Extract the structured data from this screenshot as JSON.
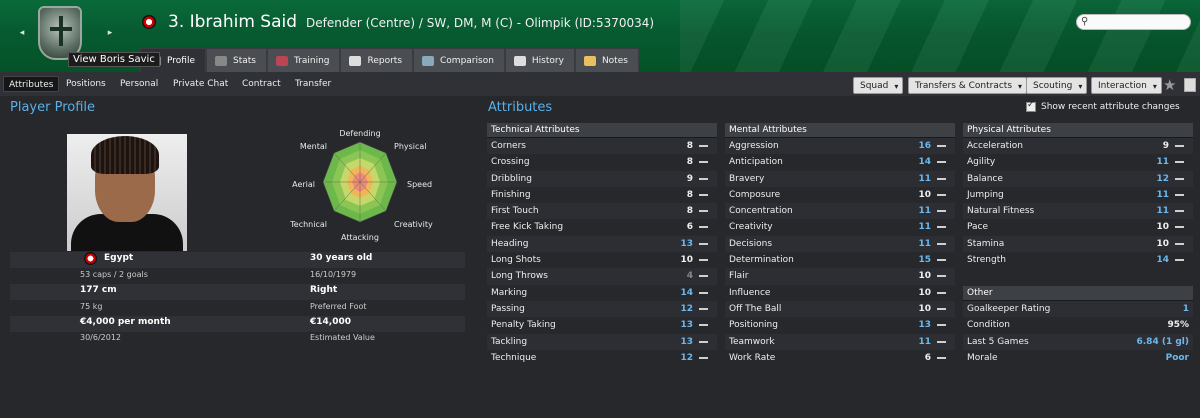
{
  "header": {
    "player_name": "3. Ibrahim Said",
    "player_sub": "Defender (Centre) / SW, DM, M (C) - Olimpik (ID:5370034)",
    "tooltip": "View Boris Savic",
    "search_placeholder": ""
  },
  "tabs": [
    "Profile",
    "Stats",
    "Training",
    "Reports",
    "Comparison",
    "History",
    "Notes"
  ],
  "subnav": [
    "Attributes",
    "Positions",
    "Personal",
    "Private Chat",
    "Contract",
    "Transfer"
  ],
  "dropdowns": [
    "Squad",
    "Transfers & Contracts",
    "Scouting",
    "Interaction"
  ],
  "profile": {
    "title": "Player Profile",
    "nation": "Egypt",
    "caps": "53 caps / 2 goals",
    "age": "30 years old",
    "dob": "16/10/1979",
    "height": "177 cm",
    "foot": "Right",
    "weight": "75 kg",
    "foot_label": "Preferred Foot",
    "wage": "€4,000 per month",
    "value": "€14,000",
    "contract_end": "30/6/2012",
    "value_label": "Estimated Value"
  },
  "radar_labels": {
    "defending": "Defending",
    "physical": "Physical",
    "speed": "Speed",
    "creativity": "Creativity",
    "attacking": "Attacking",
    "technical": "Technical",
    "aerial": "Aerial",
    "mental": "Mental"
  },
  "attributes": {
    "title": "Attributes",
    "show_changes": "Show recent attribute changes",
    "technical": {
      "title": "Technical Attributes",
      "rows": [
        {
          "name": "Corners",
          "value": "8"
        },
        {
          "name": "Crossing",
          "value": "8"
        },
        {
          "name": "Dribbling",
          "value": "9"
        },
        {
          "name": "Finishing",
          "value": "8"
        },
        {
          "name": "First Touch",
          "value": "8"
        },
        {
          "name": "Free Kick Taking",
          "value": "6"
        },
        {
          "name": "Heading",
          "value": "13"
        },
        {
          "name": "Long Shots",
          "value": "10"
        },
        {
          "name": "Long Throws",
          "value": "4"
        },
        {
          "name": "Marking",
          "value": "14"
        },
        {
          "name": "Passing",
          "value": "12"
        },
        {
          "name": "Penalty Taking",
          "value": "13"
        },
        {
          "name": "Tackling",
          "value": "13"
        },
        {
          "name": "Technique",
          "value": "12"
        }
      ]
    },
    "mental": {
      "title": "Mental Attributes",
      "rows": [
        {
          "name": "Aggression",
          "value": "16"
        },
        {
          "name": "Anticipation",
          "value": "14"
        },
        {
          "name": "Bravery",
          "value": "11"
        },
        {
          "name": "Composure",
          "value": "10"
        },
        {
          "name": "Concentration",
          "value": "11"
        },
        {
          "name": "Creativity",
          "value": "11"
        },
        {
          "name": "Decisions",
          "value": "11"
        },
        {
          "name": "Determination",
          "value": "15"
        },
        {
          "name": "Flair",
          "value": "10"
        },
        {
          "name": "Influence",
          "value": "10"
        },
        {
          "name": "Off The Ball",
          "value": "10"
        },
        {
          "name": "Positioning",
          "value": "13"
        },
        {
          "name": "Teamwork",
          "value": "11"
        },
        {
          "name": "Work Rate",
          "value": "6"
        }
      ]
    },
    "physical": {
      "title": "Physical Attributes",
      "rows": [
        {
          "name": "Acceleration",
          "value": "9"
        },
        {
          "name": "Agility",
          "value": "11"
        },
        {
          "name": "Balance",
          "value": "12"
        },
        {
          "name": "Jumping",
          "value": "11"
        },
        {
          "name": "Natural Fitness",
          "value": "11"
        },
        {
          "name": "Pace",
          "value": "10"
        },
        {
          "name": "Stamina",
          "value": "10"
        },
        {
          "name": "Strength",
          "value": "14"
        }
      ]
    },
    "other": {
      "title": "Other",
      "rows": [
        {
          "name": "Goalkeeper Rating",
          "value": "1"
        },
        {
          "name": "Condition",
          "value": "95%"
        },
        {
          "name": "Last 5 Games",
          "value": "6.84 (1 gl)"
        },
        {
          "name": "Morale",
          "value": "Poor"
        }
      ]
    }
  },
  "colors": {
    "accent": "#5ab0e8",
    "header_green": "#075a30",
    "highlight_value": "#6ab8f0"
  }
}
